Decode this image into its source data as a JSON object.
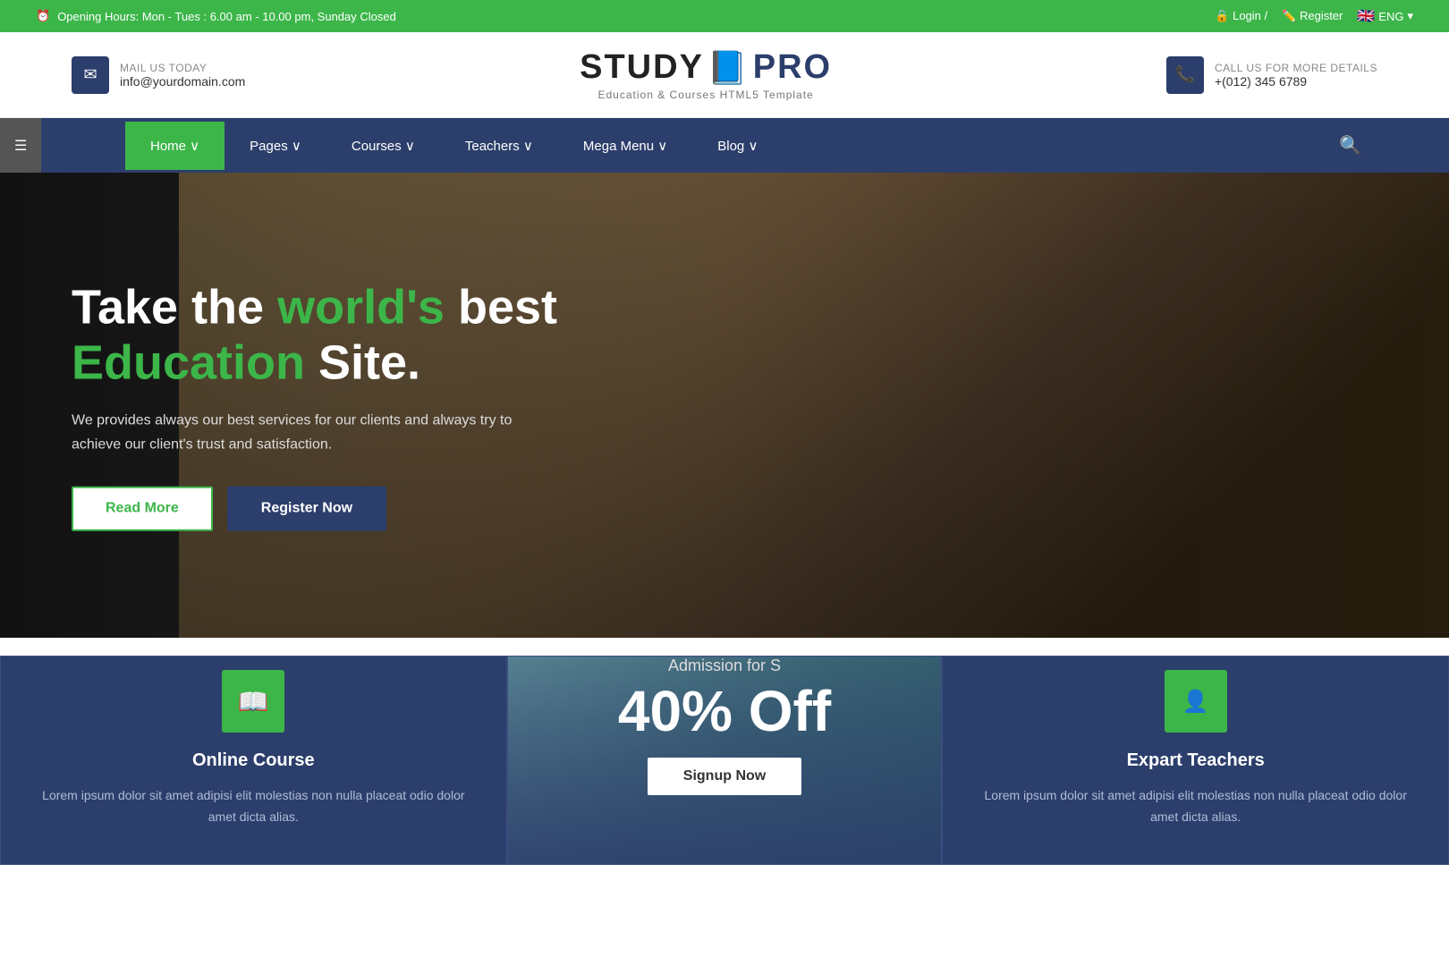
{
  "topbar": {
    "opening_hours": "Opening Hours: Mon - Tues : 6.00 am - 10.00 pm, Sunday Closed",
    "login_text": "Login /",
    "register_text": "Register",
    "language": "ENG"
  },
  "header": {
    "mail_label": "MAIL US TODAY",
    "mail_value": "info@yourdomain.com",
    "logo_name": "STUDY",
    "logo_pro": "PRO",
    "logo_sub": "Education & Courses HTML5 Template",
    "phone_label": "CALL US FOR MORE DETAILS",
    "phone_value": "+(012) 345 6789"
  },
  "nav": {
    "items": [
      {
        "label": "Home ∨",
        "active": true
      },
      {
        "label": "Pages ∨",
        "active": false
      },
      {
        "label": "Courses ∨",
        "active": false
      },
      {
        "label": "Teachers ∨",
        "active": false
      },
      {
        "label": "Mega Menu ∨",
        "active": false
      },
      {
        "label": "Blog ∨",
        "active": false
      }
    ]
  },
  "hero": {
    "title_part1": "Take the ",
    "title_highlight1": "world's",
    "title_part2": " best",
    "title_line2_highlight": "Education",
    "title_line2_end": " Site.",
    "subtitle": "We provides always our best services for our clients and always try to achieve our client's trust and satisfaction.",
    "btn_read_more": "Read More",
    "btn_register": "Register Now"
  },
  "features": [
    {
      "id": "online-course",
      "icon": "📖",
      "title": "Online Course",
      "description": "Lorem ipsum dolor sit amet adipisi elit molestias non nulla placeat odio dolor amet dicta alias."
    },
    {
      "id": "promo",
      "label": "Admission for S",
      "discount": "40% Off",
      "btn": "Signup Now"
    },
    {
      "id": "expert-teachers",
      "icon": "👤",
      "title": "Expart Teachers",
      "description": "Lorem ipsum dolor sit amet adipisi elit molestias non nulla placeat odio dolor amet dicta alias."
    }
  ]
}
